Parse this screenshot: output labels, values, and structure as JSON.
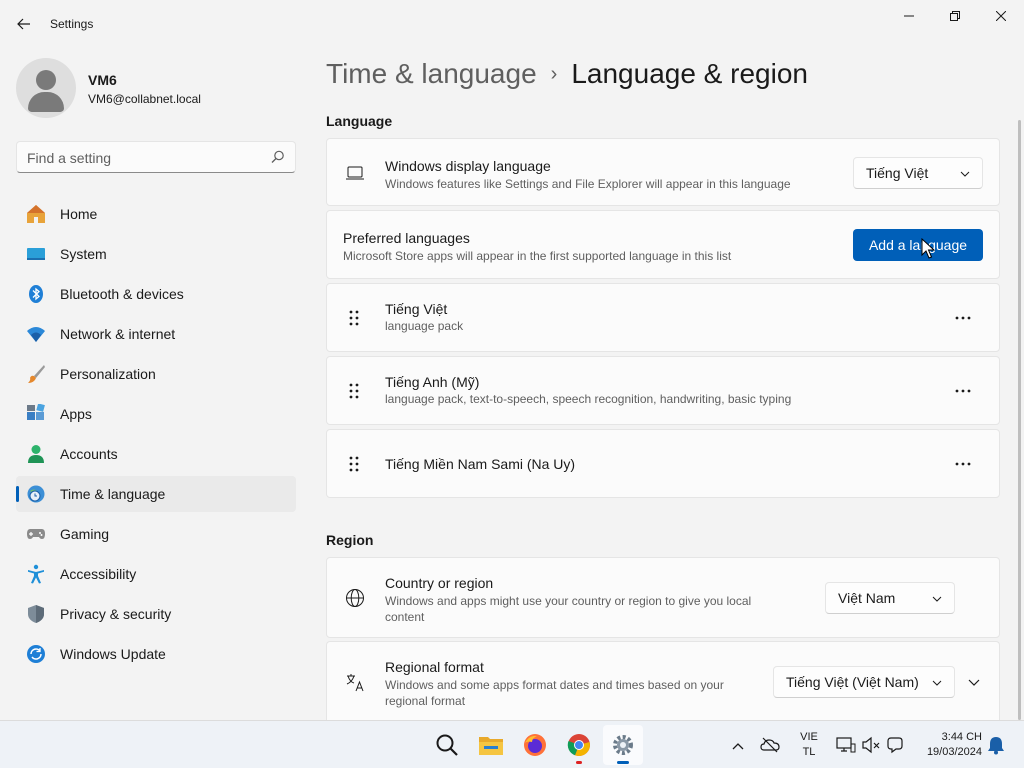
{
  "window": {
    "title": "Settings"
  },
  "user": {
    "name": "VM6",
    "email": "VM6@collabnet.local"
  },
  "search": {
    "placeholder": "Find a setting"
  },
  "sidebar": {
    "items": [
      {
        "label": "Home",
        "icon": "home-icon"
      },
      {
        "label": "System",
        "icon": "monitor-icon"
      },
      {
        "label": "Bluetooth & devices",
        "icon": "bluetooth-icon"
      },
      {
        "label": "Network & internet",
        "icon": "wifi-icon"
      },
      {
        "label": "Personalization",
        "icon": "brush-icon"
      },
      {
        "label": "Apps",
        "icon": "apps-icon"
      },
      {
        "label": "Accounts",
        "icon": "person-icon"
      },
      {
        "label": "Time & language",
        "icon": "globe-clock-icon",
        "selected": true
      },
      {
        "label": "Gaming",
        "icon": "gamepad-icon"
      },
      {
        "label": "Accessibility",
        "icon": "accessibility-icon"
      },
      {
        "label": "Privacy & security",
        "icon": "shield-icon"
      },
      {
        "label": "Windows Update",
        "icon": "update-icon"
      }
    ]
  },
  "header": {
    "parent": "Time & language",
    "separator": "›",
    "current": "Language & region"
  },
  "language": {
    "section_title": "Language",
    "display": {
      "title": "Windows display language",
      "subtitle": "Windows features like Settings and File Explorer will appear in this language",
      "value": "Tiếng Việt"
    },
    "preferred": {
      "title": "Preferred languages",
      "subtitle": "Microsoft Store apps will appear in the first supported language in this list",
      "button": "Add a language"
    },
    "list": [
      {
        "name": "Tiếng Việt",
        "detail": "language pack"
      },
      {
        "name": "Tiếng Anh (Mỹ)",
        "detail": "language pack, text-to-speech, speech recognition, handwriting, basic typing"
      },
      {
        "name": "Tiếng Miền Nam Sami (Na Uy)",
        "detail": ""
      }
    ],
    "more_glyph": "···"
  },
  "region": {
    "section_title": "Region",
    "country": {
      "title": "Country or region",
      "subtitle_line1": "Windows and apps might use your country or region to give you local",
      "subtitle_line2": "content",
      "value": "Việt Nam"
    },
    "format": {
      "title": "Regional format",
      "subtitle_line1": "Windows and some apps format dates and times based on your",
      "subtitle_line2": "regional format",
      "value": "Tiếng Việt (Việt Nam)"
    }
  },
  "taskbar": {
    "apps": [
      "search-icon",
      "file-explorer-icon",
      "firefox-icon",
      "chrome-icon",
      "settings-icon"
    ],
    "input_lang_line1": "VIE",
    "input_lang_line2": "TL",
    "time": "3:44 CH",
    "date": "19/03/2024"
  },
  "colors": {
    "accent": "#005fb8",
    "background": "#f3f3f3",
    "card": "#fbfbfb"
  }
}
